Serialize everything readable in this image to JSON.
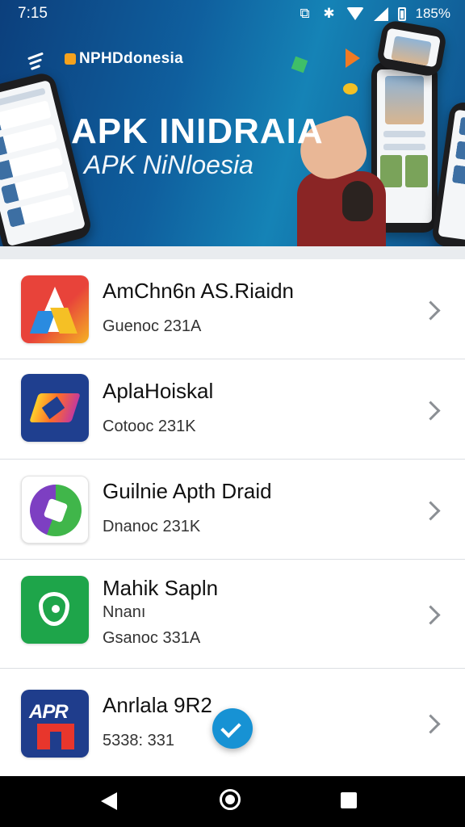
{
  "status_bar": {
    "time": "7:15",
    "battery": "185%"
  },
  "banner": {
    "brand": "NPHDdonesia",
    "title": "APK INIDRAIA",
    "subtitle": "APK NiNloesia"
  },
  "apps": [
    {
      "name": "AmChn6n AS.Riaidn",
      "extra": "",
      "meta": "Guenoc 231A",
      "icon": "app-a-icon"
    },
    {
      "name": "AplaHoiskal",
      "extra": "",
      "meta": "Cotooc 231K",
      "icon": "app-zigzag-icon"
    },
    {
      "name": "Guilnie Apth Draid",
      "extra": "",
      "meta": "Dnanoc 231K",
      "icon": "app-ring-icon"
    },
    {
      "name": "Mahik Sapln",
      "extra": "Nnanı",
      "meta": "Gsanoc 331A",
      "icon": "app-drop-icon"
    },
    {
      "name": "Anrlala 9R2",
      "extra": "",
      "meta": "5338: 331",
      "icon": "app-apr-icon"
    }
  ],
  "icon5_text": "APR",
  "colors": {
    "accent": "#1792d4",
    "banner": "#0f5f9e",
    "navbar": "#000000"
  }
}
